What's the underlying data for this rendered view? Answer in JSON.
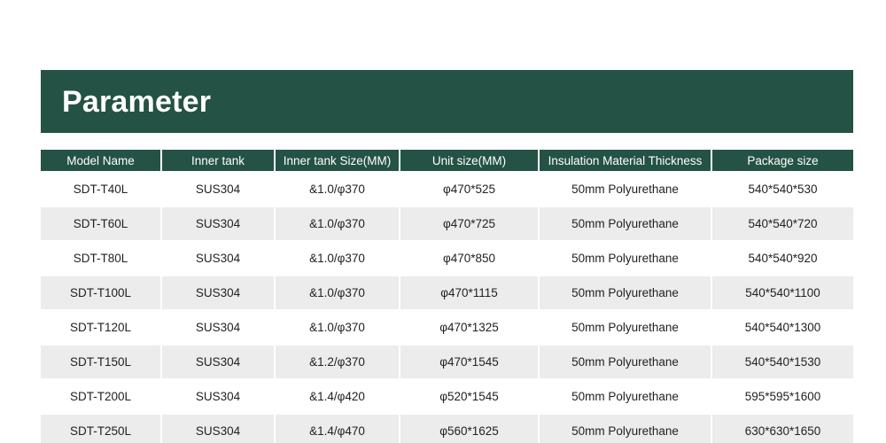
{
  "banner": {
    "title": "Parameter"
  },
  "table": {
    "columns": [
      "Model Name",
      "Inner tank",
      "Inner tank Size(MM)",
      "Unit size(MM)",
      "Insulation Material Thickness",
      "Package size"
    ],
    "rows": [
      [
        "SDT-T40L",
        "SUS304",
        "&1.0/φ370",
        "φ470*525",
        "50mm Polyurethane",
        "540*540*530"
      ],
      [
        "SDT-T60L",
        "SUS304",
        "&1.0/φ370",
        "φ470*725",
        "50mm Polyurethane",
        "540*540*720"
      ],
      [
        "SDT-T80L",
        "SUS304",
        "&1.0/φ370",
        "φ470*850",
        "50mm Polyurethane",
        "540*540*920"
      ],
      [
        "SDT-T100L",
        "SUS304",
        "&1.0/φ370",
        "φ470*1115",
        "50mm Polyurethane",
        "540*540*1100"
      ],
      [
        "SDT-T120L",
        "SUS304",
        "&1.0/φ370",
        "φ470*1325",
        "50mm Polyurethane",
        "540*540*1300"
      ],
      [
        "SDT-T150L",
        "SUS304",
        "&1.2/φ370",
        "φ470*1545",
        "50mm Polyurethane",
        "540*540*1530"
      ],
      [
        "SDT-T200L",
        "SUS304",
        "&1.4/φ420",
        "φ520*1545",
        "50mm Polyurethane",
        "595*595*1600"
      ],
      [
        "SDT-T250L",
        "SUS304",
        "&1.4/φ470",
        "φ560*1625",
        "50mm Polyurethane",
        "630*630*1650"
      ]
    ]
  },
  "colors": {
    "brand_green": "#245244",
    "header_text": "#ffffff",
    "stripe_gray": "#ececec"
  }
}
